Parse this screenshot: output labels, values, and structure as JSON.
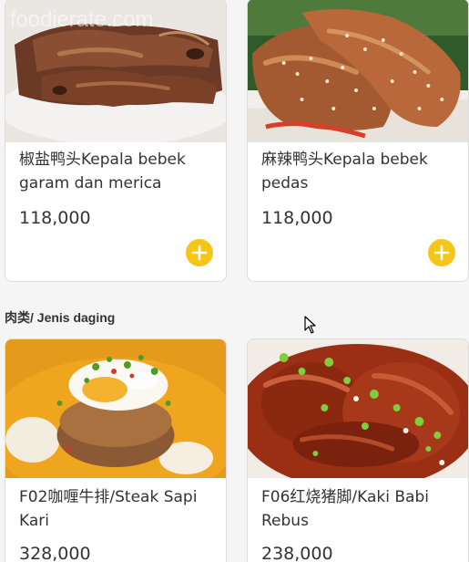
{
  "watermark": "foodierate.com",
  "section": {
    "title": "肉类/ Jenis daging"
  },
  "items": [
    {
      "name": "椒盐鸭头Kepala bebek garam dan merica",
      "price": "118,000"
    },
    {
      "name": "麻辣鸭头Kepala bebek pedas",
      "price": "118,000"
    },
    {
      "name": "F02咖喱牛排/Steak Sapi Kari",
      "price": "328,000"
    },
    {
      "name": "F06红烧猪脚/Kaki Babi Rebus",
      "price": "238,000"
    }
  ],
  "colors": {
    "accent": "#f5c518",
    "background": "#f5f5f5",
    "card": "#ffffff",
    "text": "#333333"
  },
  "icons": {
    "add": "plus-icon",
    "cursor": "mouse-pointer-icon"
  }
}
